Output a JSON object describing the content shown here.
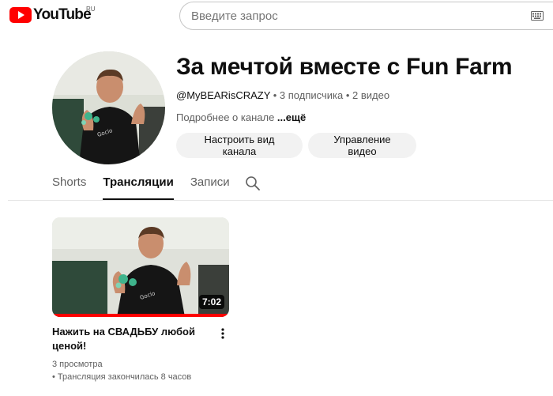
{
  "header": {
    "logo_text": "YouTube",
    "region": "RU",
    "search_placeholder": "Введите запрос"
  },
  "channel": {
    "title": "За мечтой вместе с Fun Farm",
    "handle": "@MyBEARisCRAZY",
    "meta_rest": " • 3 подписчика • 2 видео",
    "about_text": "Подробнее о канале ",
    "about_more": "...ещё",
    "customize_button": "Настроить вид канала",
    "manage_button": "Управление видео"
  },
  "tabs": [
    {
      "label": "Shorts",
      "active": false
    },
    {
      "label": "Трансляции",
      "active": true
    },
    {
      "label": "Записи",
      "active": false
    }
  ],
  "video": {
    "title": "Нажить на СВАДЬБУ любой ценой!",
    "duration": "7:02",
    "views": "3 просмотра",
    "status": "• Трансляция закончилась 8 часов",
    "watched_fraction": 1.0
  },
  "colors": {
    "brand_red": "#ff0000",
    "button_bg": "#f2f2f2",
    "secondary_text": "#606060"
  }
}
